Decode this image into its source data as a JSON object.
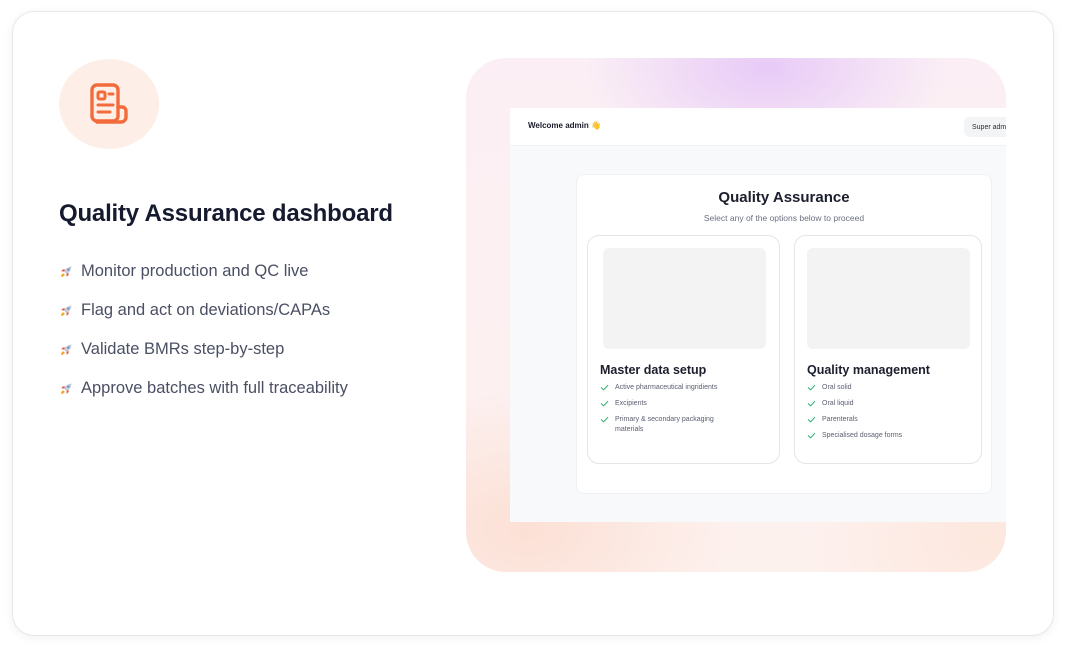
{
  "feature": {
    "icon": "document-list-icon",
    "accent_color": "#f26b3a",
    "title": "Quality Assurance dashboard",
    "bullet_icon": "rocket-icon",
    "items": [
      "Monitor production and QC live",
      "Flag and act on deviations/CAPAs",
      "Validate BMRs step-by-step",
      "Approve batches with full traceability"
    ]
  },
  "preview": {
    "header": {
      "welcome": "Welcome admin 👋",
      "role": "Super admin"
    },
    "panel": {
      "title": "Quality Assurance",
      "subtitle": "Select any of the options below to proceed",
      "check_color": "#3fb37f",
      "options": [
        {
          "title": "Master data setup",
          "items": [
            "Active pharmaceutical ingridients",
            "Excipients",
            "Primary & secondary packaging materials"
          ]
        },
        {
          "title": "Quality management",
          "items": [
            "Oral solid",
            "Oral liquid",
            "Parenterals",
            "Specialised dosage forms"
          ]
        }
      ]
    }
  }
}
